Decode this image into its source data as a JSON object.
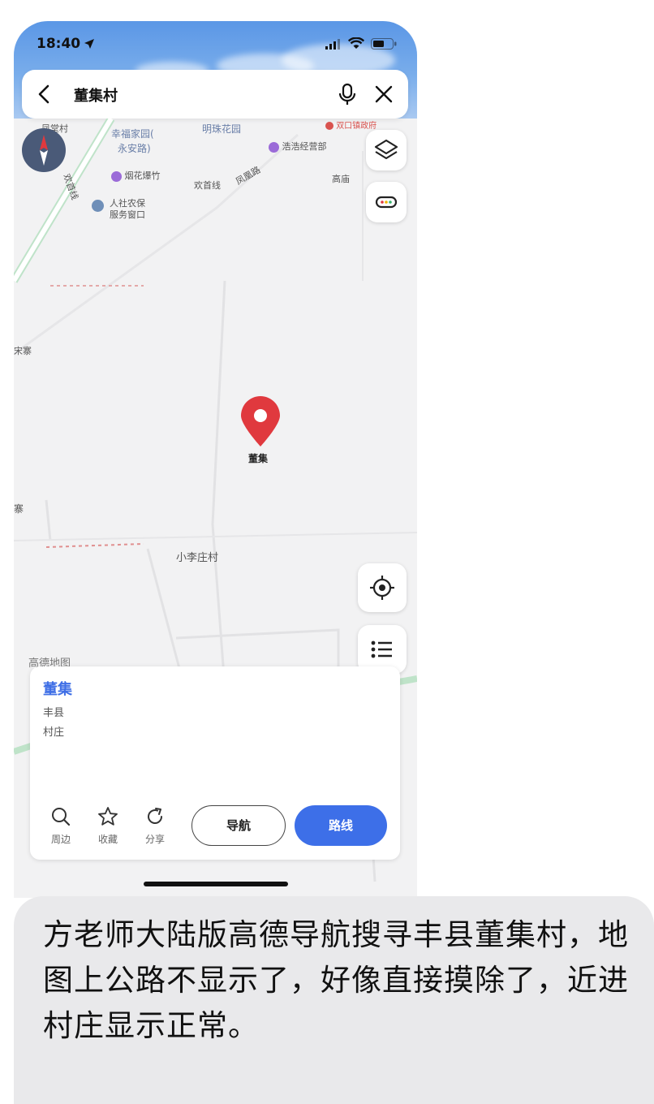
{
  "status_bar": {
    "time": "18:40"
  },
  "search": {
    "query": "董集村"
  },
  "map": {
    "labels": {
      "fengmaocun": "凤堂村",
      "xingfu": "幸福家园(",
      "yongan": "永安路)",
      "mingzhu": "明珠花园",
      "haohao": "浩浩经营部",
      "yanhua": "烟花爆竹",
      "huanshouxian": "欢首线",
      "fenghuanglu": "凤凰路",
      "gaomiao": "高庙",
      "renshe1": "人社农保",
      "renshe2": "服务窗口",
      "road_vertical": "欢首线",
      "songzhai": "宋寨",
      "zhai": "寨",
      "xiaolizhuang": "小李庄村",
      "watermark": "高德地图",
      "top_poi": "双口镇政府"
    },
    "pin_label": "董集"
  },
  "place_card": {
    "title": "董集",
    "county": "丰县",
    "type": "村庄",
    "actions": {
      "nearby": "周边",
      "favorite": "收藏",
      "share": "分享"
    },
    "navigate_label": "导航",
    "route_label": "路线"
  },
  "message": {
    "text": "方老师大陆版高德导航搜寻丰县董集村，地图上公路不显示了，好像直接摸除了，近进村庄显示正常。"
  },
  "colors": {
    "accent": "#3d6fe8",
    "pin": "#e0393e",
    "bubble": "#e9e9eb"
  }
}
